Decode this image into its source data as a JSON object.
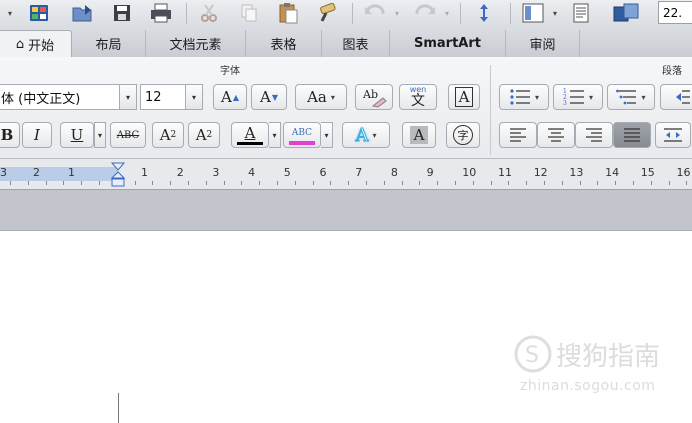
{
  "toolbar": {
    "zoom_value": "22.",
    "dropdown_arrow": "▾"
  },
  "tabs": [
    {
      "label": "开始",
      "active": true
    },
    {
      "label": "布局"
    },
    {
      "label": "文档元素"
    },
    {
      "label": "表格"
    },
    {
      "label": "图表"
    },
    {
      "label": "SmartArt"
    },
    {
      "label": "审阅"
    }
  ],
  "home_icon": "⌂",
  "font_group": {
    "title": "字体",
    "font_name": "体 (中文正文)",
    "font_size": "12",
    "grow_label": "A",
    "shrink_label": "A",
    "case_label": "Aa",
    "phonetic_top": "wen",
    "phonetic_char": "文",
    "border_label": "A",
    "bold": "B",
    "italic": "I",
    "underline": "U",
    "strike": "ABC",
    "superscript_base": "A",
    "superscript_mark": "2",
    "subscript_base": "A",
    "subscript_mark": "2",
    "font_color_label": "A",
    "highlight_label": "ABC",
    "effects_label": "A",
    "shading_label": "A",
    "enclose_char": "字",
    "font_color": "#000000",
    "highlight_color": "#e33fd0",
    "effects_color": "#5ec7ee"
  },
  "paragraph_group": {
    "title": "段落"
  },
  "ruler": {
    "left_numbers": [
      "3",
      "2",
      "1"
    ],
    "right_numbers": [
      "1",
      "2",
      "3",
      "4",
      "5",
      "6",
      "7",
      "8",
      "9",
      "10",
      "11",
      "12",
      "13",
      "14",
      "15",
      "16"
    ]
  },
  "watermark": {
    "name": "搜狗指南",
    "url": "zhinan.sogou.com"
  }
}
